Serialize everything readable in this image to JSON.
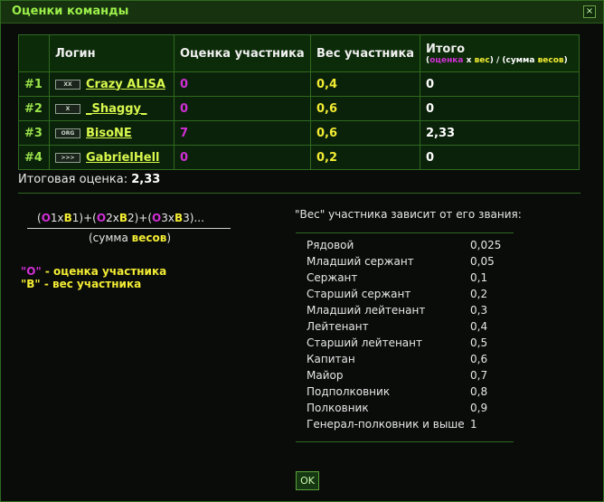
{
  "window": {
    "title": "Оценки команды",
    "close_glyph": "×"
  },
  "table": {
    "headers": {
      "rank": "",
      "login": "Логин",
      "score": "Оценка участника",
      "weight": "Вес участника",
      "total": "Итого",
      "total_sub_open": "(",
      "total_sub_score": "оценка",
      "total_sub_x": " x ",
      "total_sub_weight": "вес",
      "total_sub_mid": ") / (сумма ",
      "total_sub_weights": "весов",
      "total_sub_close": ")"
    },
    "rows": [
      {
        "rank": "#1",
        "badge": "XX",
        "login": "Crazy ALISA",
        "score": "0",
        "weight": "0,4",
        "total": "0"
      },
      {
        "rank": "#2",
        "badge": "X",
        "login": "_Shaggy_",
        "score": "0",
        "weight": "0,6",
        "total": "0"
      },
      {
        "rank": "#3",
        "badge": "ORG",
        "login": "BisoNE",
        "score": "7",
        "weight": "0,6",
        "total": "2,33"
      },
      {
        "rank": "#4",
        "badge": ">>>",
        "login": "GabrielHell",
        "score": "0",
        "weight": "0,2",
        "total": "0"
      }
    ]
  },
  "final": {
    "label": "Итоговая оценка:",
    "value": "2,33"
  },
  "formula": {
    "open1": "(",
    "o1": "О",
    "i1": "1x",
    "b1": "В",
    "j1": "1)+(",
    "o2": "О",
    "i2": "2x",
    "b2": "В",
    "j2": "2)+(",
    "o3": "О",
    "i3": "3x",
    "b3": "В",
    "j3": "3)...",
    "den_open": "(сумма ",
    "den_w": "весов",
    "den_close": ")"
  },
  "legend": {
    "o_key": "\"О\"",
    "o_text": " - оценка участника",
    "v_key": "\"В\"",
    "v_text": " - вес участника"
  },
  "ranks": {
    "title": "\"Вес\" участника зависит от его звания:",
    "items": [
      {
        "name": "Рядовой",
        "value": "0,025"
      },
      {
        "name": "Младший сержант",
        "value": "0,05"
      },
      {
        "name": "Сержант",
        "value": "0,1"
      },
      {
        "name": "Старший сержант",
        "value": "0,2"
      },
      {
        "name": "Младший лейтенант",
        "value": "0,3"
      },
      {
        "name": "Лейтенант",
        "value": "0,4"
      },
      {
        "name": "Старший лейтенант",
        "value": "0,5"
      },
      {
        "name": "Капитан",
        "value": "0,6"
      },
      {
        "name": "Майор",
        "value": "0,7"
      },
      {
        "name": "Подполковник",
        "value": "0,8"
      },
      {
        "name": "Полковник",
        "value": "0,9"
      },
      {
        "name": "Генерал-полковник и выше",
        "value": "1"
      }
    ]
  },
  "ok_label": "OK",
  "colors": {
    "score": "#d12fd6",
    "weight": "#f2ec33",
    "login": "#d9f94d",
    "title": "#9cf04a"
  }
}
